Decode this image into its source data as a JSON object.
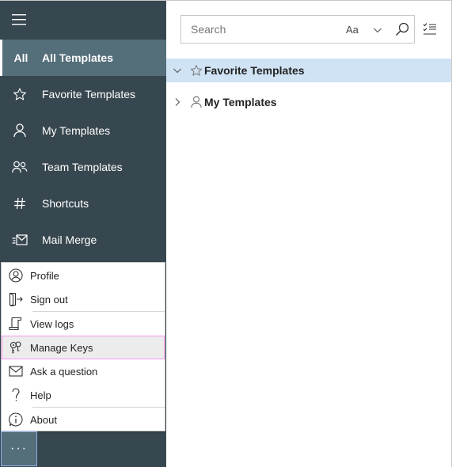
{
  "sidebar": {
    "menu_icon": "hamburger-icon",
    "items": [
      {
        "label": "All Templates",
        "icon_text": "All",
        "icon": "all-icon",
        "active": true
      },
      {
        "label": "Favorite Templates",
        "icon": "star-icon"
      },
      {
        "label": "My Templates",
        "icon": "person-icon"
      },
      {
        "label": "Team Templates",
        "icon": "people-icon"
      },
      {
        "label": "Shortcuts",
        "icon": "hash-icon"
      },
      {
        "label": "Mail Merge",
        "icon": "mail-merge-icon"
      }
    ],
    "more_button": "···"
  },
  "search": {
    "placeholder": "Search",
    "value": "",
    "match_case_label": "Aa"
  },
  "tree": [
    {
      "label": "Favorite Templates",
      "expanded": true,
      "selected": true,
      "icon": "star-icon"
    },
    {
      "label": "My Templates",
      "expanded": false,
      "selected": false,
      "icon": "person-icon"
    }
  ],
  "menu": {
    "items": [
      {
        "label": "Profile",
        "icon": "profile-icon"
      },
      {
        "label": "Sign out",
        "icon": "sign-out-icon"
      },
      {
        "label": "View logs",
        "icon": "logs-icon"
      },
      {
        "label": "Manage Keys",
        "icon": "keys-icon",
        "hovered": true
      },
      {
        "label": "Ask a question",
        "icon": "envelope-icon"
      },
      {
        "label": "Help",
        "icon": "help-icon"
      },
      {
        "label": "About",
        "icon": "info-icon"
      }
    ]
  },
  "colors": {
    "sidebar_bg": "#37474f",
    "sidebar_active": "#546e7a",
    "selected_row": "#cfe3f4",
    "hover_outline": "#f79bf2"
  }
}
